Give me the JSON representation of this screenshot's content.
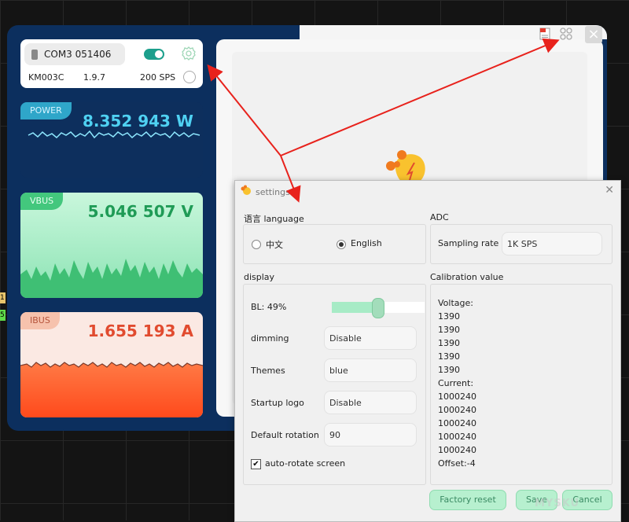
{
  "side_markers": {
    "m1": "1",
    "m2": "5"
  },
  "device": {
    "port": "COM3 051406",
    "model": "KM003C",
    "version": "1.9.7",
    "rate": "200 SPS"
  },
  "measurements": {
    "power": {
      "tag": "POWER",
      "value": "8.352 943 W"
    },
    "vbus": {
      "tag": "VBUS",
      "value": "5.046 507 V"
    },
    "ibus": {
      "tag": "IBUS",
      "value": "1.655 193 A"
    }
  },
  "settings": {
    "title": "settings",
    "language": {
      "label": "语言 language",
      "options": [
        "中文",
        "English"
      ],
      "selected": "English"
    },
    "adc": {
      "label": "ADC",
      "sampling_label": "Sampling rate",
      "sampling_value": "1K SPS"
    },
    "display": {
      "label": "display",
      "bl_label": "BL: 49%",
      "bl_value": 0.49,
      "dimming_label": "dimming",
      "dimming_value": "Disable",
      "themes_label": "Themes",
      "themes_value": "blue",
      "startup_label": "Startup logo",
      "startup_value": "Disable",
      "rotation_label": "Default rotation",
      "rotation_value": "90",
      "autorotate_label": "auto-rotate screen",
      "autorotate_checked": true
    },
    "calibration": {
      "label": "Calibration value",
      "lines": [
        "Voltage:",
        "1390",
        "1390",
        "1390",
        "1390",
        "1390",
        "Current:",
        "1000240",
        "1000240",
        "1000240",
        "1000240",
        "1000240",
        "Offset:-4"
      ]
    },
    "buttons": {
      "factory_reset": "Factory reset",
      "save": "Save",
      "cancel": "Cancel"
    }
  },
  "watermark": "MYSKU",
  "colors": {
    "accent": "#1c9f8c",
    "arrow": "#e8221c"
  }
}
